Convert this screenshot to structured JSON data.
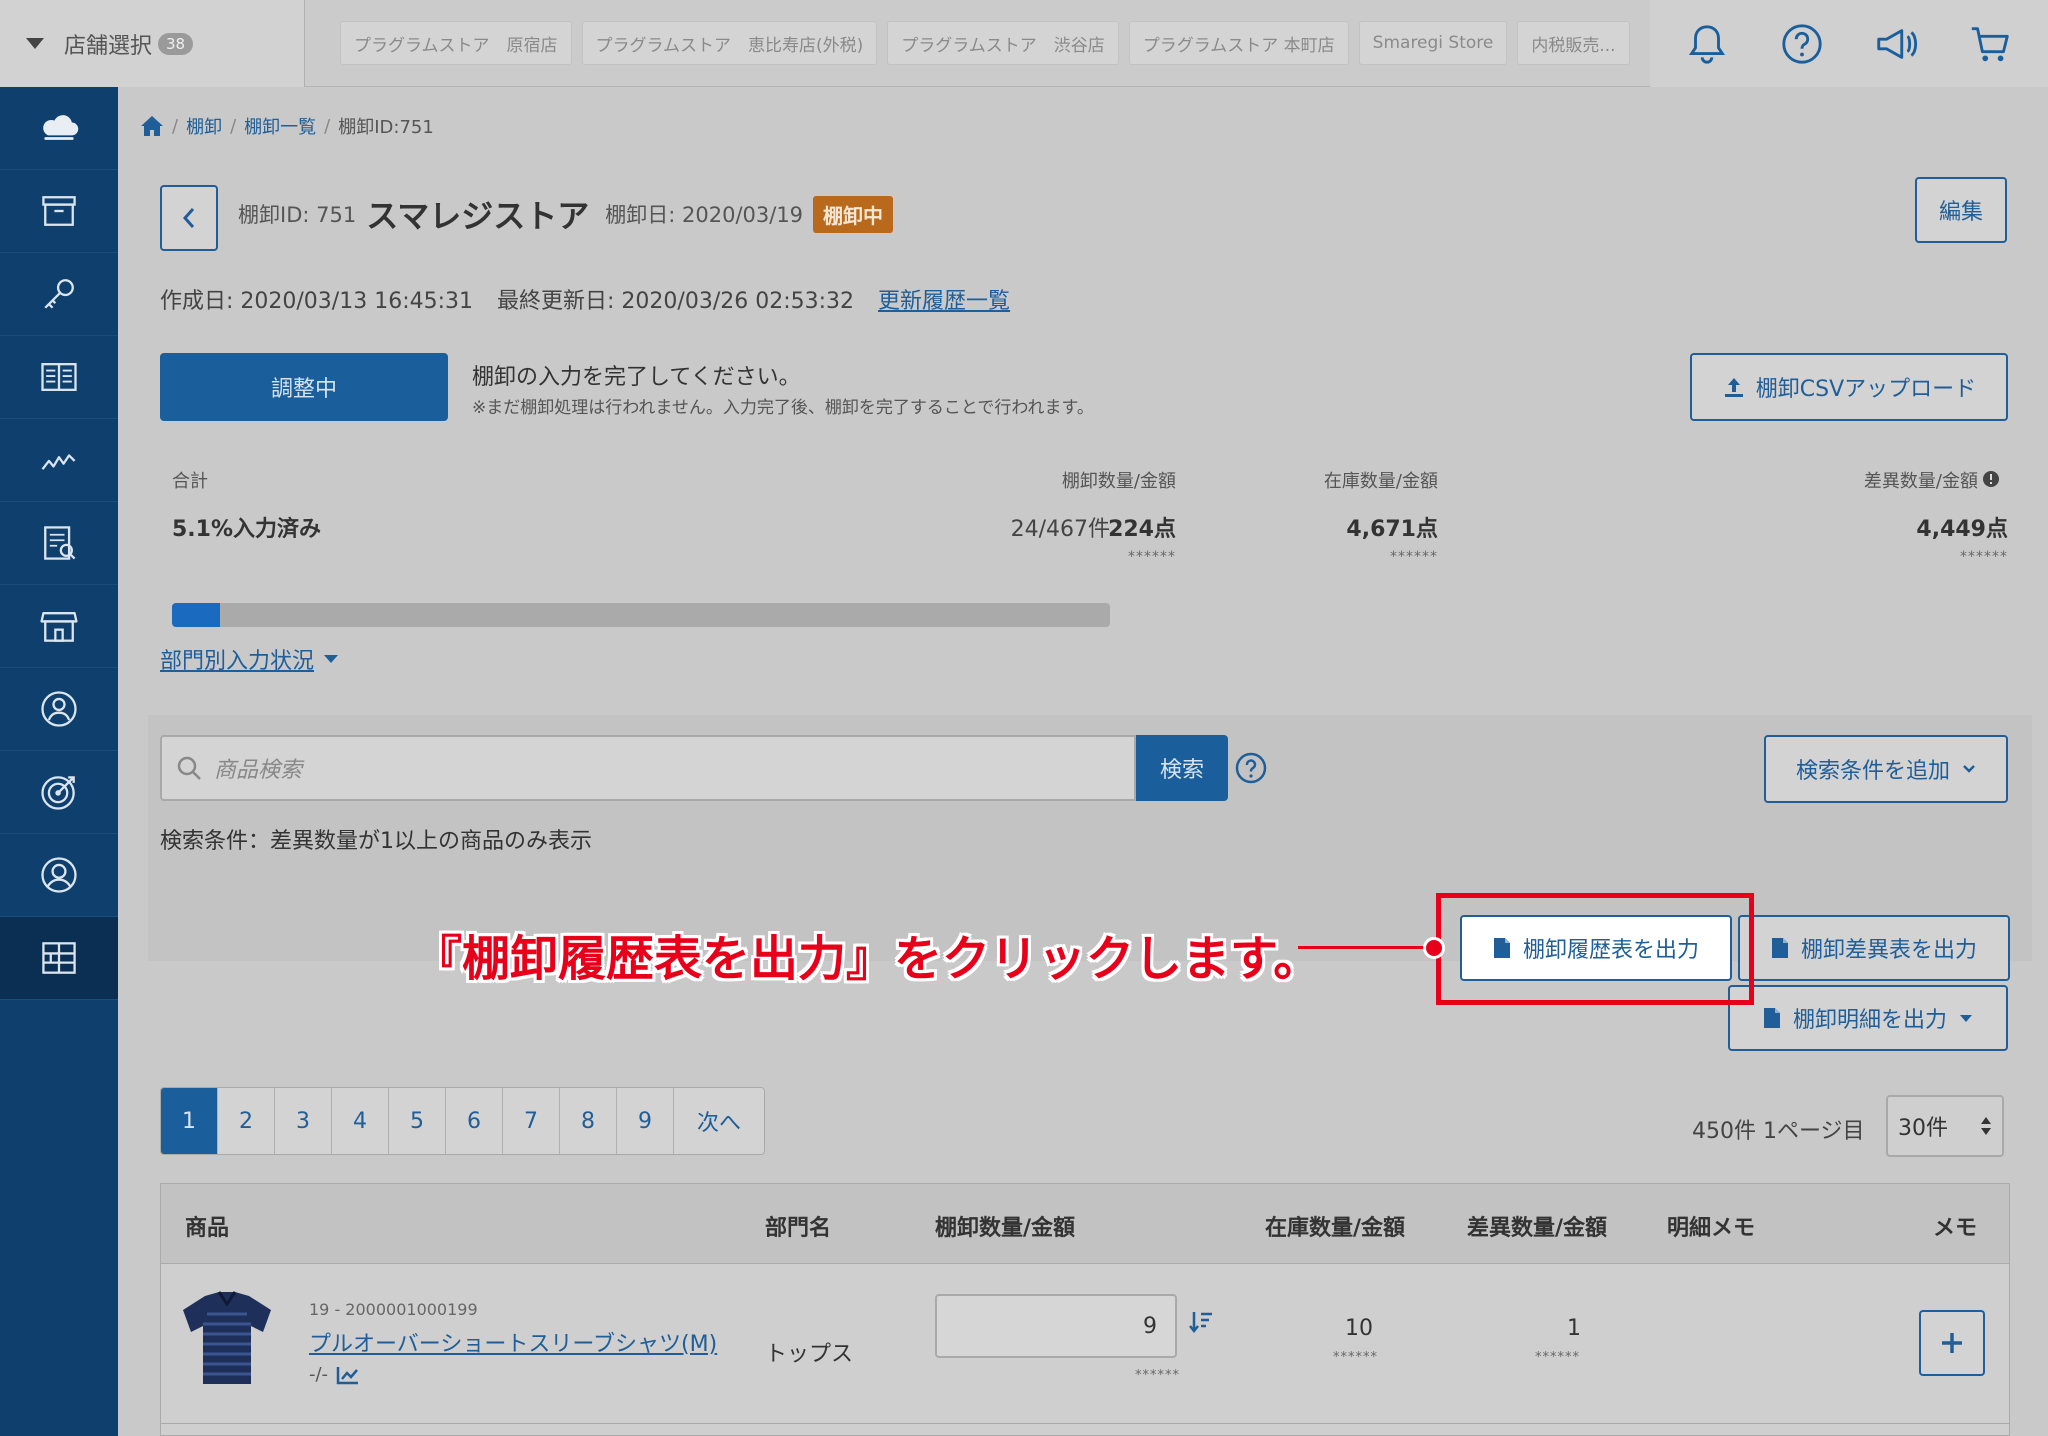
{
  "topbar": {
    "store_select_label": "店舗選択",
    "store_count": "38",
    "store_tabs": [
      "プラグラムストア　原宿店",
      "プラグラムストア　恵比寿店(外税)",
      "プラグラムストア　渋谷店",
      "プラグラムストア 本町店",
      "Smaregi Store",
      "内税販売..."
    ],
    "icons": [
      "bell-icon",
      "help-icon",
      "megaphone-icon",
      "cart-icon"
    ]
  },
  "sidebar": {
    "items": [
      "cloud-icon",
      "archive-icon",
      "key-icon",
      "book-icon",
      "chart-icon",
      "report-icon",
      "store-icon",
      "user-icon",
      "target-icon",
      "member-icon",
      "grid-icon"
    ],
    "active_index": 10
  },
  "breadcrumb": {
    "items": [
      "棚卸",
      "棚卸一覧",
      "棚卸ID:751"
    ]
  },
  "header": {
    "id_label": "棚卸ID: 751",
    "store_name": "スマレジストア",
    "date_label": "棚卸日: 2020/03/19",
    "status": "棚卸中",
    "edit_label": "編集"
  },
  "meta": {
    "created": "作成日: 2020/03/13 16:45:31",
    "updated": "最終更新日: 2020/03/26 02:53:32",
    "history_link": "更新履歴一覧"
  },
  "action": {
    "adjust_label": "調整中",
    "notice": "棚卸の入力を完了してください。",
    "notice_sub": "※まだ棚卸処理は行われません。入力完了後、棚卸を完了することで行われます。",
    "csv_upload_label": "棚卸CSVアップロード"
  },
  "summary": {
    "total_label": "合計",
    "progress_text": "5.1%入力済み",
    "progress_fraction": 0.051,
    "count_text": "24/467件",
    "cols": [
      {
        "label": "棚卸数量/金額",
        "value": "224点",
        "mask": "******"
      },
      {
        "label": "在庫数量/金額",
        "value": "4,671点",
        "mask": "******"
      },
      {
        "label": "差異数量/金額",
        "value": "4,449点",
        "mask": "******"
      }
    ],
    "dept_link": "部門別入力状況"
  },
  "search": {
    "placeholder": "商品検索",
    "button_label": "検索",
    "add_condition_label": "検索条件を追加",
    "condition_text": "検索条件：差異数量が1以上の商品のみ表示"
  },
  "outputs": {
    "history_label": "棚卸履歴表を出力",
    "diff_label": "棚卸差異表を出力",
    "detail_label": "棚卸明細を出力"
  },
  "callout": {
    "text": "『棚卸履歴表を出力』をクリックします。"
  },
  "pagination": {
    "pages": [
      "1",
      "2",
      "3",
      "4",
      "5",
      "6",
      "7",
      "8",
      "9"
    ],
    "next_label": "次へ",
    "active": "1",
    "count_text": "450件 1ページ目",
    "per_page": "30件"
  },
  "table": {
    "headers": [
      "商品",
      "部門名",
      "棚卸数量/金額",
      "在庫数量/金額",
      "差異数量/金額",
      "明細メモ",
      "メモ"
    ],
    "rows": [
      {
        "code": "19 - 2000001000199",
        "name": "プルオーバーショートスリーブシャツ(M)",
        "variant": "-/-",
        "department": "トップス",
        "count_qty": "9",
        "count_mask": "******",
        "stock_qty": "10",
        "stock_mask": "******",
        "diff_qty": "1",
        "diff_mask": "******"
      }
    ]
  },
  "colors": {
    "primary": "#1a5f9c",
    "sidebar": "#0f3f6d",
    "status": "#b8691c",
    "callout": "#e8001b"
  }
}
